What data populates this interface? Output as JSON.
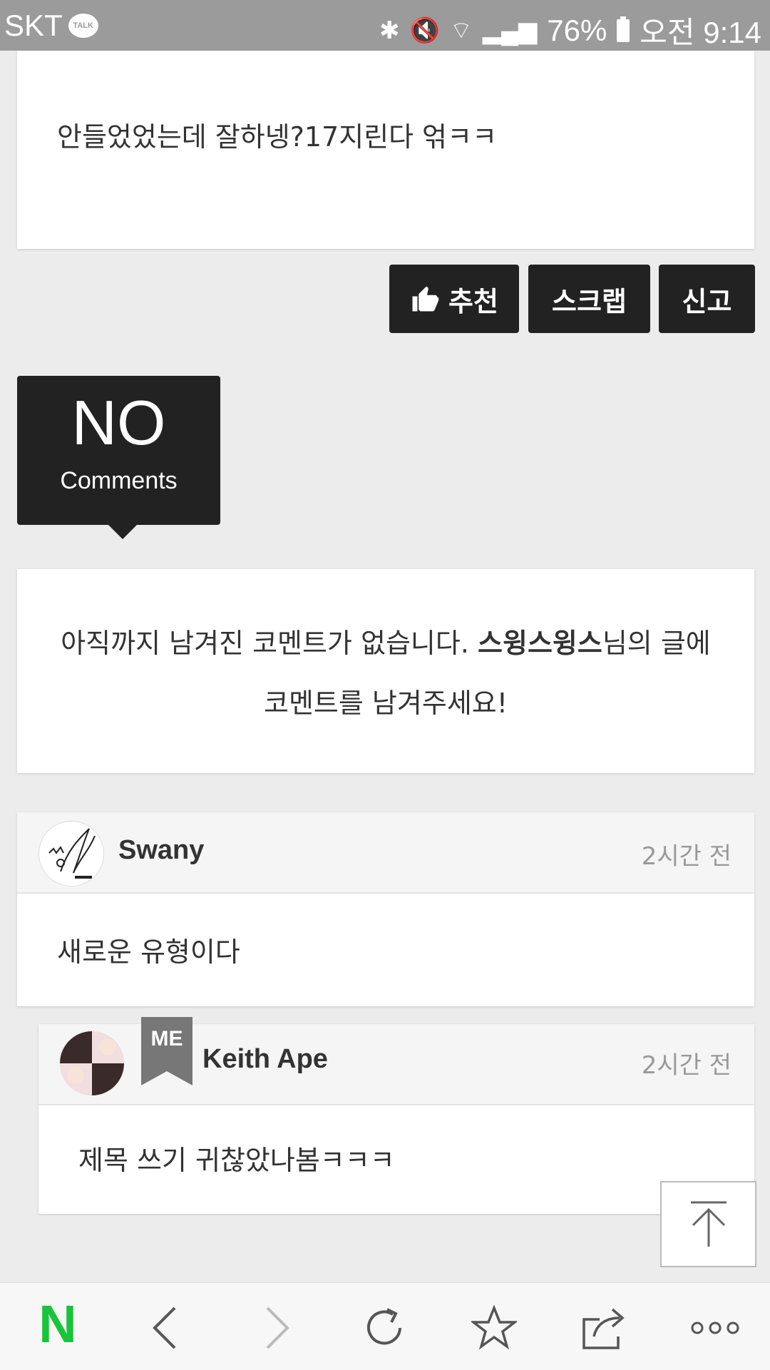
{
  "status_bar": {
    "carrier": "SKT",
    "talk_badge": "TALK",
    "battery": "76%",
    "time": "오전 9:14"
  },
  "post": {
    "text": "안들었었는데 잘하넹?17지린다 얶ㅋㅋ"
  },
  "actions": {
    "recommend_label": "추천",
    "scrap_label": "스크랩",
    "report_label": "신고"
  },
  "comments_count": {
    "big": "NO",
    "small": "Comments"
  },
  "empty_notice": {
    "prefix": "아직까지 남겨진 코멘트가 없습니다. ",
    "author": "스윙스윙스",
    "suffix": "님의 글에 코멘트를 남겨주세요!"
  },
  "comments": [
    {
      "author": "Swany",
      "time": "2시간 전",
      "text": "새로운 유형이다"
    },
    {
      "badge": "ME",
      "author": "Keith Ape",
      "time": "2시간 전",
      "text": "제목 쓰기 귀찮았나봄ㅋㅋㅋ"
    }
  ],
  "nav": {
    "logo": "N",
    "items": [
      "back-icon",
      "forward-icon",
      "refresh-icon",
      "bookmark-star-icon",
      "share-icon",
      "more-icon"
    ]
  },
  "colors": {
    "dark_button": "#222222",
    "background": "#ececec",
    "naver_green": "#19c43a"
  }
}
